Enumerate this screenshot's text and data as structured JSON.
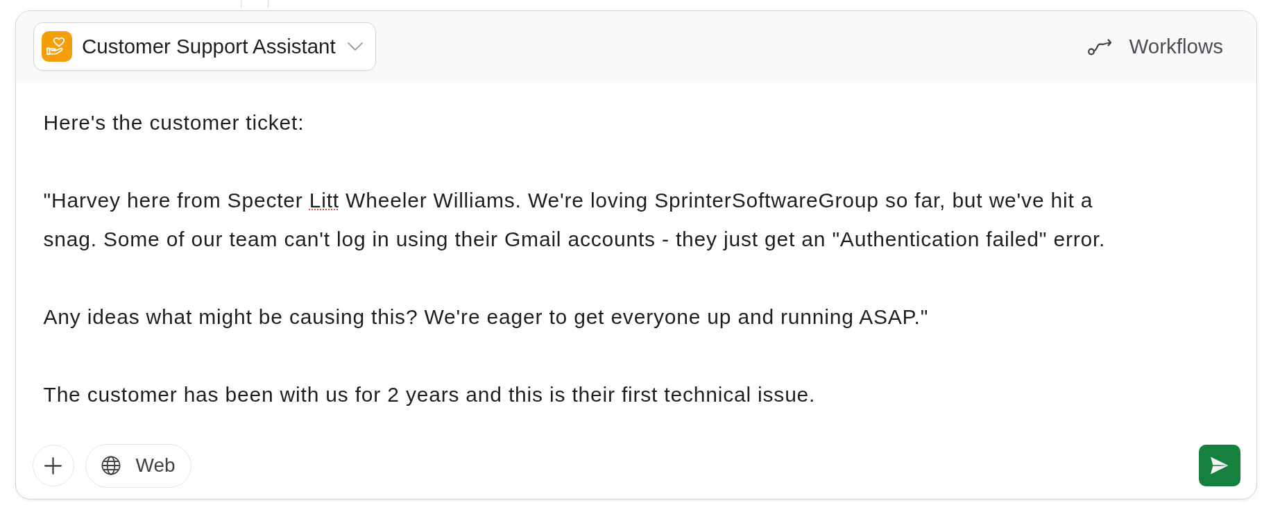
{
  "assistant_selector": {
    "label": "Customer Support Assistant"
  },
  "workflows_button": {
    "label": "Workflows"
  },
  "message": {
    "paragraphs": [
      {
        "runs": [
          {
            "text": "Here's the customer ticket:",
            "misspelled": false
          }
        ]
      },
      {
        "runs": [
          {
            "text": "\"Harvey here from Specter ",
            "misspelled": false
          },
          {
            "text": "Litt",
            "misspelled": true
          },
          {
            "text": " Wheeler Williams. We're loving SprinterSoftwareGroup so far, but we've hit a snag. Some of our team can't log in using their Gmail accounts - they just get an \"Authentication failed\" error.",
            "misspelled": false
          }
        ]
      },
      {
        "runs": [
          {
            "text": "Any ideas what might be causing this? We're eager to get everyone up and running ASAP.\"",
            "misspelled": false
          }
        ]
      },
      {
        "runs": [
          {
            "text": "The customer has been with us for 2 years and this is their first technical issue.",
            "misspelled": false
          }
        ]
      }
    ]
  },
  "web_button": {
    "label": "Web"
  }
}
